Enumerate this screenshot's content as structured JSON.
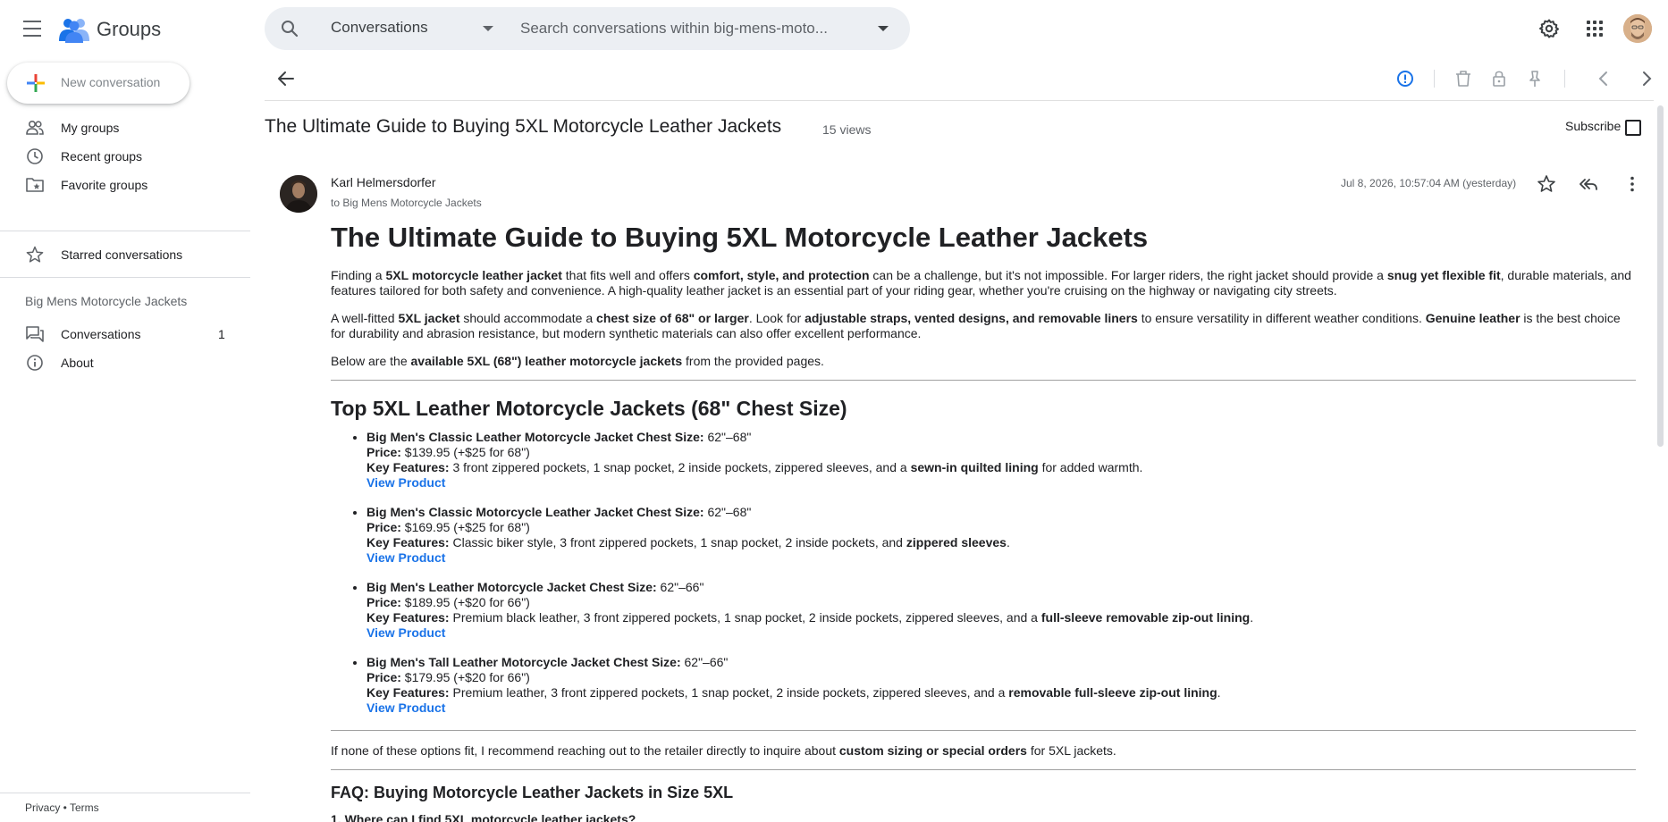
{
  "app": {
    "name": "Groups",
    "brand_colors": {
      "blue": "#4285f4",
      "red": "#ea4335",
      "yellow": "#fbbc04",
      "green": "#34a853",
      "link": "#1a73e8"
    }
  },
  "search": {
    "scope": "Conversations",
    "placeholder": "Search conversations within big-mens-moto..."
  },
  "sidebar": {
    "new_conversation": "New conversation",
    "items": [
      {
        "label": "My groups",
        "icon": "people-icon"
      },
      {
        "label": "Recent groups",
        "icon": "clock-icon"
      },
      {
        "label": "Favorite groups",
        "icon": "folder-star-icon"
      },
      {
        "label": "Starred conversations",
        "icon": "star-icon"
      }
    ],
    "group_name": "Big Mens Motorcycle Jackets",
    "group_items": [
      {
        "label": "Conversations",
        "count": "1",
        "icon": "forum-icon"
      },
      {
        "label": "About",
        "icon": "info-icon"
      }
    ],
    "footer": {
      "privacy": "Privacy",
      "separator": " • ",
      "terms": "Terms"
    }
  },
  "thread": {
    "title": "The Ultimate Guide to Buying 5XL Motorcycle Leather Jackets",
    "views": "15 views",
    "subscribe_label": "Subscribe"
  },
  "post": {
    "author": "Karl Helmersdorfer",
    "to": "to Big Mens Motorcycle Jackets",
    "date": "Jul 8, 2026, 10:57:04 AM (yesterday)",
    "heading": "The Ultimate Guide to Buying 5XL Motorcycle Leather Jackets",
    "intro1": {
      "t1": "Finding a ",
      "b1": "5XL motorcycle leather jacket",
      "t2": " that fits well and offers ",
      "b2": "comfort, style, and protection",
      "t3": " can be a challenge, but it's not impossible. For larger riders, the right jacket should provide a ",
      "b3": "snug yet flexible fit",
      "t4": ", durable materials, and features tailored for both safety and convenience. A high-quality leather jacket is an essential part of your riding gear, whether you're cruising on the highway or navigating city streets."
    },
    "intro2": {
      "t1": "A well-fitted ",
      "b1": "5XL jacket",
      "t2": " should accommodate a ",
      "b2": "chest size of 68\" or larger",
      "t3": ". Look for ",
      "b3": "adjustable straps, vented designs, and removable liners",
      "t4": " to ensure versatility in different weather conditions. ",
      "b4": "Genuine leather",
      "t5": " is the best choice for durability and abrasion resistance, but modern synthetic materials can also offer excellent performance."
    },
    "intro3": {
      "t1": "Below are the ",
      "b1": "available 5XL (68\") leather motorcycle jackets",
      "t2": " from the provided pages."
    },
    "products_heading": "Top 5XL Leather Motorcycle Jackets (68\" Chest Size)",
    "labels": {
      "price": "Price:",
      "features": "Key Features:",
      "link": "View Product"
    },
    "products": [
      {
        "name": "Big Men's Classic Leather Motorcycle Jacket Chest Size:",
        "chest": " 62\"–68\"",
        "price": " $139.95 (+$25 for 68\")",
        "features": " 3 front zippered pockets, 1 snap pocket, 2 inside pockets, zippered sleeves, and a ",
        "features_bold": "sewn-in quilted lining",
        "features_end": " for added warmth."
      },
      {
        "name": "Big Men's Classic Motorcycle Leather Jacket Chest Size:",
        "chest": " 62\"–68\"",
        "price": " $169.95 (+$25 for 68\")",
        "features": " Classic biker style, 3 front zippered pockets, 1 snap pocket, 2 inside pockets, and ",
        "features_bold": "zippered sleeves",
        "features_end": "."
      },
      {
        "name": "Big Men's Leather Motorcycle Jacket Chest Size:",
        "chest": " 62\"–66\"",
        "price": " $189.95 (+$20 for 66\")",
        "features": " Premium black leather, 3 front zippered pockets, 1 snap pocket, 2 inside pockets, zippered sleeves, and a ",
        "features_bold": "full-sleeve removable zip-out lining",
        "features_end": "."
      },
      {
        "name": "Big Men's Tall Leather Motorcycle Jacket Chest Size:",
        "chest": " 62\"–66\"",
        "price": " $179.95 (+$20 for 66\")",
        "features": " Premium leather, 3 front zippered pockets, 1 snap pocket, 2 inside pockets, zippered sleeves, and a ",
        "features_bold": "removable full-sleeve zip-out lining",
        "features_end": "."
      }
    ],
    "outro": {
      "t1": "If none of these options fit, I recommend reaching out to the retailer directly to inquire about ",
      "b1": "custom sizing or special orders",
      "t2": " for 5XL jackets."
    },
    "faq_heading": "FAQ: Buying Motorcycle Leather Jackets in Size 5XL",
    "faq_q1": "1. Where can I find 5XL motorcycle leather jackets?"
  }
}
